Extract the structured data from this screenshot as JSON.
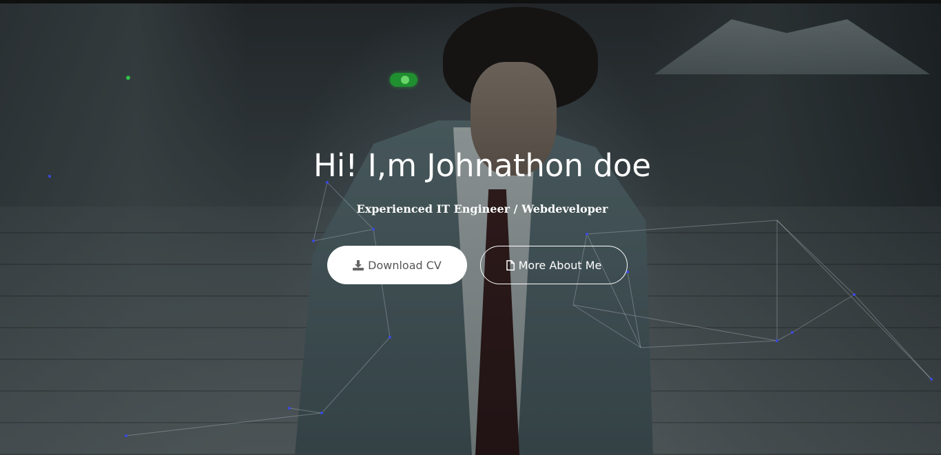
{
  "hero": {
    "headline": "Hi! I,m Johnathon doe",
    "subtitle": "Experienced IT Engineer / Webdeveloper",
    "accent_color": "#1f8f2f"
  },
  "buttons": {
    "download_cv": {
      "label": "Download CV",
      "icon": "download-icon"
    },
    "more_about": {
      "label": "More About Me",
      "icon": "file-icon"
    }
  }
}
